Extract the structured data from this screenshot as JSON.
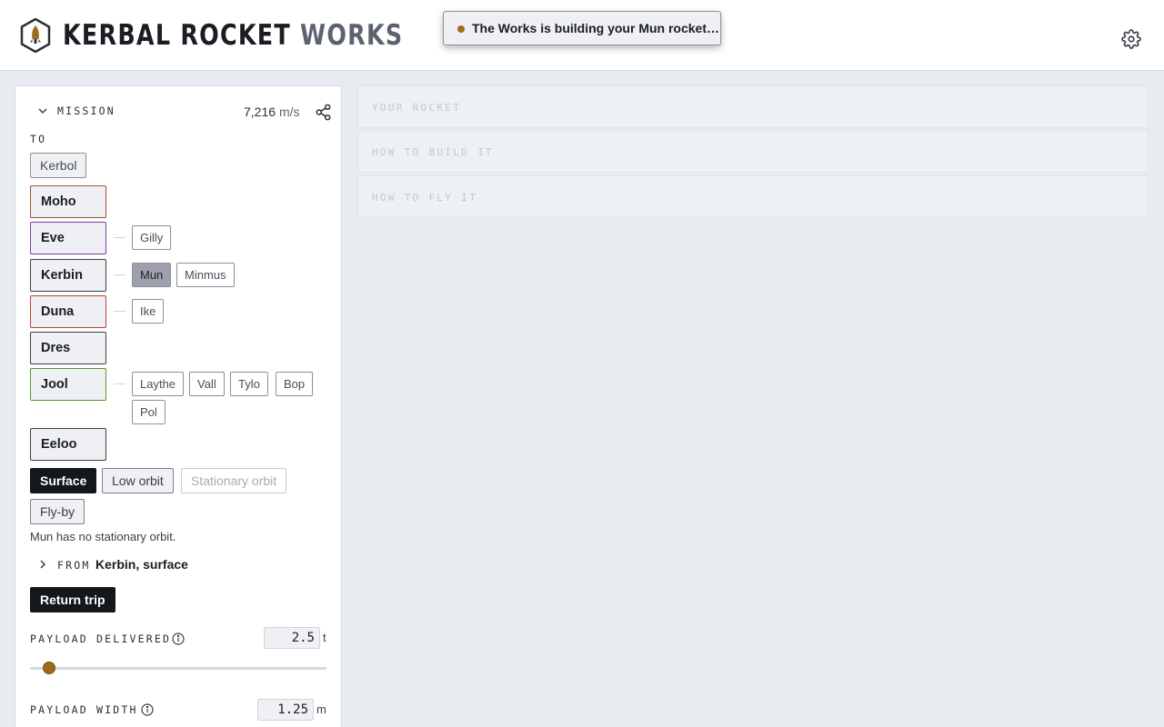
{
  "header": {
    "brand_main": "KERBAL ROCKET",
    "brand_accent": "WORKS"
  },
  "toast": {
    "message": "The Works is building your Mun rocket…"
  },
  "mission": {
    "label": "MISSION",
    "delta_v": "7,216",
    "delta_v_unit": "m/s",
    "to_label": "TO",
    "sun": "Kerbol",
    "planets": [
      {
        "name": "Moho",
        "color": "#a0522d",
        "moons": []
      },
      {
        "name": "Eve",
        "color": "#7b3fa0",
        "moons": [
          {
            "name": "Gilly",
            "selected": false
          }
        ]
      },
      {
        "name": "Kerbin",
        "color": "#3a3e45",
        "moons": [
          {
            "name": "Mun",
            "selected": true
          },
          {
            "name": "Minmus",
            "selected": false
          }
        ]
      },
      {
        "name": "Duna",
        "color": "#b5452b",
        "moons": [
          {
            "name": "Ike",
            "selected": false
          }
        ]
      },
      {
        "name": "Dres",
        "color": "#3a3e45",
        "moons": []
      },
      {
        "name": "Jool",
        "color": "#5a9a2a",
        "moons": [
          {
            "name": "Laythe",
            "selected": false
          },
          {
            "name": "Vall",
            "selected": false
          },
          {
            "name": "Tylo",
            "selected": false
          },
          {
            "name": "Bop",
            "selected": false
          },
          {
            "name": "Pol",
            "selected": false
          }
        ]
      },
      {
        "name": "Eeloo",
        "color": "#3a3e45",
        "moons": []
      }
    ],
    "orbit_options": [
      {
        "label": "Surface",
        "state": "selected"
      },
      {
        "label": "Low orbit",
        "state": "available"
      },
      {
        "label": "Stationary orbit",
        "state": "disabled"
      },
      {
        "label": "Fly-by",
        "state": "available"
      }
    ],
    "note": "Mun has no stationary orbit.",
    "from_label": "FROM",
    "from_value": "Kerbin, surface",
    "return_trip": "Return trip",
    "payload_delivered": {
      "label": "PAYLOAD DELIVERED",
      "value": "2.5",
      "unit": "t",
      "slider_fraction": 0.065
    },
    "payload_width": {
      "label": "PAYLOAD WIDTH",
      "value": "1.25",
      "unit": "m"
    }
  },
  "sections": [
    {
      "title": "YOUR ROCKET"
    },
    {
      "title": "HOW TO BUILD IT"
    },
    {
      "title": "HOW TO FLY IT"
    }
  ],
  "colors": {
    "accent": "#a06a1c",
    "dark": "#14171c",
    "background": "#e8ebf0"
  }
}
